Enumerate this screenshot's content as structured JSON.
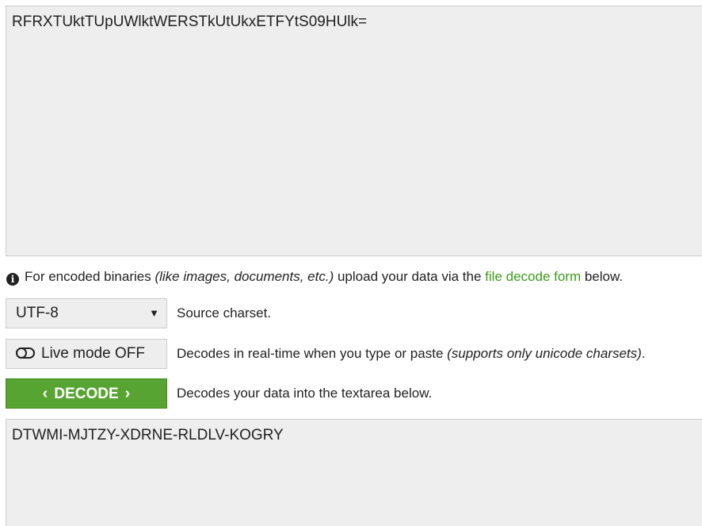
{
  "input": {
    "value": "RFRXTUktTUpUWlktWERSTkUtUkxETFYtS09HUlk="
  },
  "info": {
    "prefix": "For encoded binaries ",
    "italic": "(like images, documents, etc.)",
    "middle": " upload your data via the ",
    "link": "file decode form",
    "suffix": " below.",
    "icon": "info-circle-icon"
  },
  "charset": {
    "selected": "UTF-8",
    "description": "Source charset."
  },
  "live_mode": {
    "label": "Live mode OFF",
    "description_prefix": "Decodes in real-time when you type or paste ",
    "description_italic": "(supports only unicode charsets)",
    "description_suffix": "."
  },
  "decode": {
    "label": "DECODE",
    "description": "Decodes your data into the textarea below."
  },
  "output": {
    "value": "DTWMI-MJTZY-XDRNE-RLDLV-KOGRY"
  },
  "colors": {
    "accent": "#57a432",
    "link": "#3d9b1a",
    "field_bg": "#eeeeee"
  }
}
